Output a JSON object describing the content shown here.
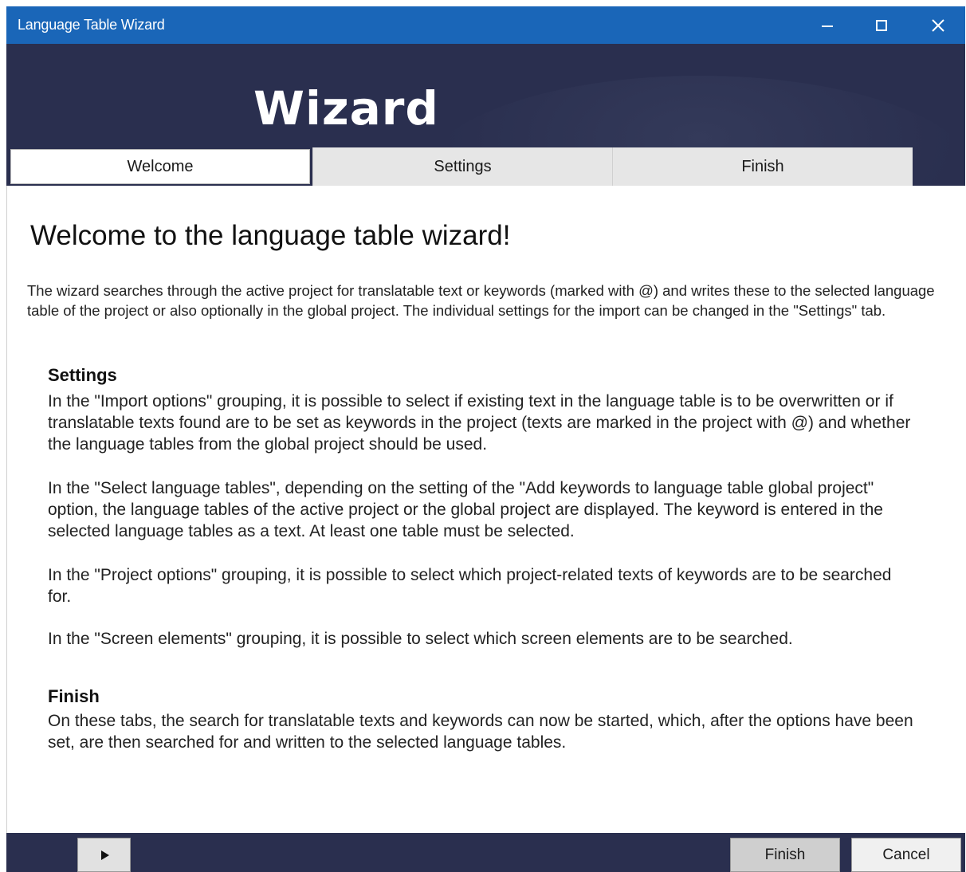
{
  "window": {
    "title": "Language Table Wizard"
  },
  "banner": {
    "heading": "Wizard"
  },
  "tabs": [
    {
      "label": "Welcome",
      "active": true
    },
    {
      "label": "Settings",
      "active": false
    },
    {
      "label": "Finish",
      "active": false
    }
  ],
  "content": {
    "title": "Welcome to the language table wizard!",
    "intro": "The wizard searches through the active project for translatable text or keywords (marked with @) and writes these to the selected language table of the project or also optionally in the global project. The individual settings for the import can be changed in the \"Settings\" tab.",
    "settings_heading": "Settings",
    "settings_paragraphs": [
      "In the \"Import options\" grouping, it is possible to select if existing text in the language table is to be overwritten or if translatable texts found are to be set as keywords in the project (texts are marked in the project with @) and whether the language tables from the global project should be used.",
      "In the \"Select language tables\", depending on the setting of the \"Add keywords to language table global project\" option, the language tables of the active project or the global project are displayed. The keyword is entered in the selected language tables as a text. At least one table must be selected.",
      "In the \"Project options\" grouping, it is possible to select which project-related texts of keywords are to be searched for.",
      "In the \"Screen elements\" grouping, it is possible to select which screen elements are to be searched."
    ],
    "finish_heading": "Finish",
    "finish_paragraph": "On these tabs, the search for translatable texts and keywords can now be started, which, after the options have been set, are then searched for and written to the selected language tables."
  },
  "footer": {
    "next_icon": "play-icon",
    "finish_label": "Finish",
    "cancel_label": "Cancel"
  },
  "colors": {
    "titlebar": "#1a66b8",
    "banner": "#2a2f4f",
    "tab_inactive": "#e6e6e6"
  }
}
